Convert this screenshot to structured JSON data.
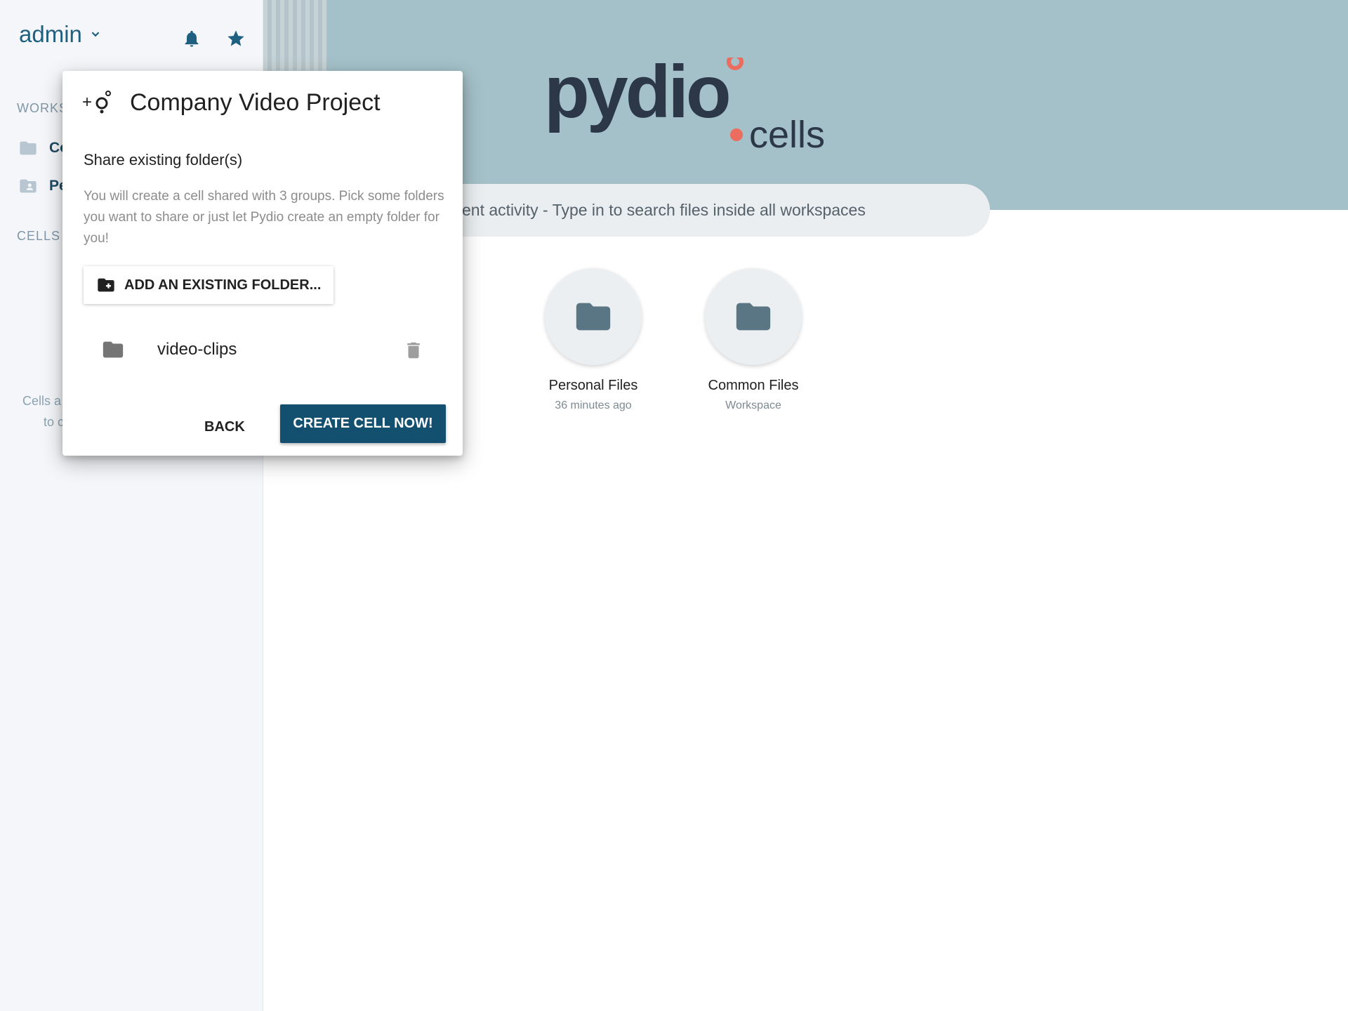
{
  "sidebar": {
    "user": {
      "name": "admin"
    },
    "workspaces_label": "WORKS",
    "workspaces": [
      {
        "label": "Co",
        "icon": "folder-icon"
      },
      {
        "label": "Pe",
        "icon": "person-folder-icon"
      }
    ],
    "cells_label": "CELLS",
    "cells_help": {
      "line1": "Cells a",
      "line2": "to c"
    }
  },
  "main": {
    "logo": {
      "main": "pydio",
      "sub": "cells"
    },
    "search": {
      "placeholder": "ent activity - Type in to search files inside all workspaces"
    },
    "tiles": [
      {
        "title": "Personal Files",
        "subtitle": "36 minutes ago",
        "icon": "folder-icon"
      },
      {
        "title": "Common Files",
        "subtitle": "Workspace",
        "icon": "folder-icon"
      }
    ]
  },
  "dialog": {
    "title": "Company Video Project",
    "subtitle": "Share existing folder(s)",
    "description": "You will create a cell shared with 3 groups. Pick some folders you want to share or just let Pydio create an empty folder for you!",
    "add_folder_label": "ADD AN EXISTING FOLDER...",
    "folders": [
      {
        "name": "video-clips"
      }
    ],
    "back_label": "BACK",
    "create_label": "CREATE CELL NOW!"
  },
  "colors": {
    "accent": "#134f6e",
    "banner": "#a4c0c8",
    "logo_dark": "#2c3847",
    "logo_accent": "#ea6d5f"
  }
}
